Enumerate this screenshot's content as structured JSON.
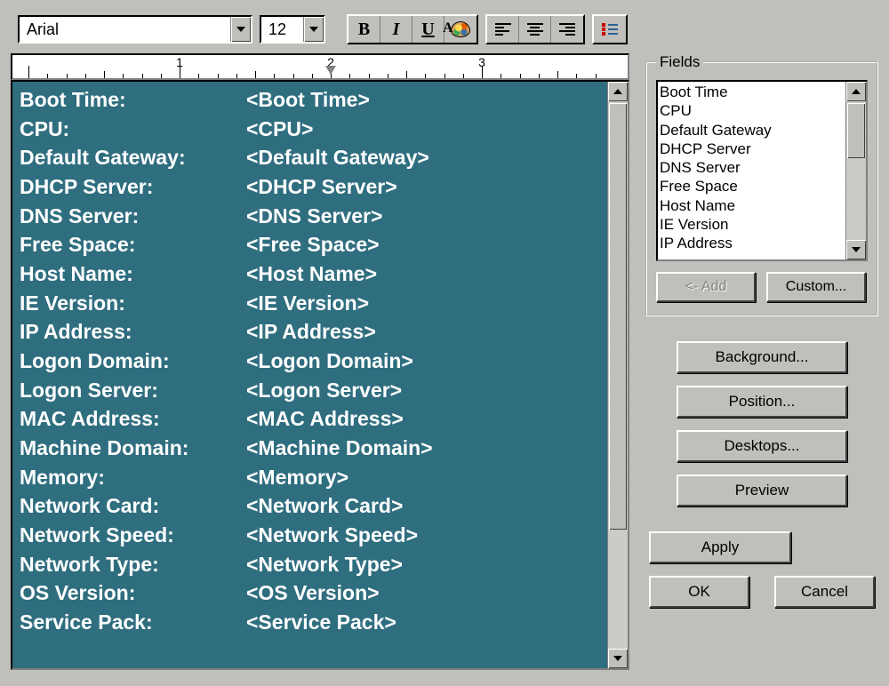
{
  "toolbar": {
    "font": "Arial",
    "size": "12"
  },
  "ruler": {
    "labels": [
      "1",
      "2",
      "3"
    ]
  },
  "editor": {
    "rows": [
      {
        "label": "Boot Time:",
        "value": "<Boot Time>"
      },
      {
        "label": "CPU:",
        "value": "<CPU>"
      },
      {
        "label": "Default Gateway:",
        "value": "<Default Gateway>"
      },
      {
        "label": "DHCP Server:",
        "value": "<DHCP Server>"
      },
      {
        "label": "DNS Server:",
        "value": "<DNS Server>"
      },
      {
        "label": "Free Space:",
        "value": "<Free Space>"
      },
      {
        "label": "Host Name:",
        "value": "<Host Name>"
      },
      {
        "label": "IE Version:",
        "value": "<IE Version>"
      },
      {
        "label": "IP Address:",
        "value": "<IP Address>"
      },
      {
        "label": "Logon Domain:",
        "value": "<Logon Domain>"
      },
      {
        "label": "Logon Server:",
        "value": "<Logon Server>"
      },
      {
        "label": "MAC Address:",
        "value": "<MAC Address>"
      },
      {
        "label": "Machine Domain:",
        "value": "<Machine Domain>"
      },
      {
        "label": "Memory:",
        "value": "<Memory>"
      },
      {
        "label": "Network Card:",
        "value": "<Network Card>"
      },
      {
        "label": "Network Speed:",
        "value": "<Network Speed>"
      },
      {
        "label": "Network Type:",
        "value": "<Network Type>"
      },
      {
        "label": "OS Version:",
        "value": "<OS Version>"
      },
      {
        "label": "Service Pack:",
        "value": "<Service Pack>"
      }
    ]
  },
  "fields": {
    "legend": "Fields",
    "items": [
      "Boot Time",
      "CPU",
      "Default Gateway",
      "DHCP Server",
      "DNS Server",
      "Free Space",
      "Host Name",
      "IE Version",
      "IP Address"
    ],
    "add_label": "<- Add",
    "custom_label": "Custom..."
  },
  "side_buttons": {
    "background": "Background...",
    "position": "Position...",
    "desktops": "Desktops...",
    "preview": "Preview"
  },
  "bottom_buttons": {
    "apply": "Apply",
    "ok": "OK",
    "cancel": "Cancel"
  }
}
